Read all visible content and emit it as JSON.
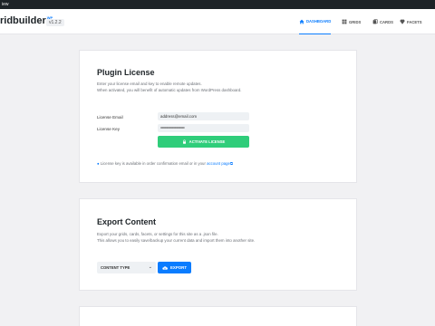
{
  "wp_admin_bar": {
    "label": "iew"
  },
  "header": {
    "logo_text": "ridbuilder",
    "logo_sup": "WP",
    "version": "v1.2.2",
    "nav": [
      {
        "label": "DASHBOARD",
        "icon": "home-icon",
        "active": true
      },
      {
        "label": "GRIDS",
        "icon": "grid-icon",
        "active": false
      },
      {
        "label": "CARDS",
        "icon": "cards-icon",
        "active": false
      },
      {
        "label": "FACETS",
        "icon": "diamond-icon",
        "active": false
      }
    ]
  },
  "license": {
    "title": "Plugin License",
    "desc1": "Enter your license email and key to enable remote updates.",
    "desc2": "When activated, you will benefit of automatic updates from WordPress dashboard.",
    "email_label": "License Email",
    "email_value": "address@email.com",
    "key_label": "License Key",
    "key_value": "••••••••••••••••••••••••••••••••••••",
    "activate_label": "ACTIVATE LICENSE",
    "note_text": "License key is available in order confirmation email or in your ",
    "note_link": "account page"
  },
  "export": {
    "title": "Export Content",
    "desc1": "Export your grids, cards, facets, or settings for this site as a .json file.",
    "desc2": "This allows you to easily save/backup your current data and import them into another site.",
    "select_value": "CONTENT TYPE",
    "export_label": "EXPORT"
  }
}
